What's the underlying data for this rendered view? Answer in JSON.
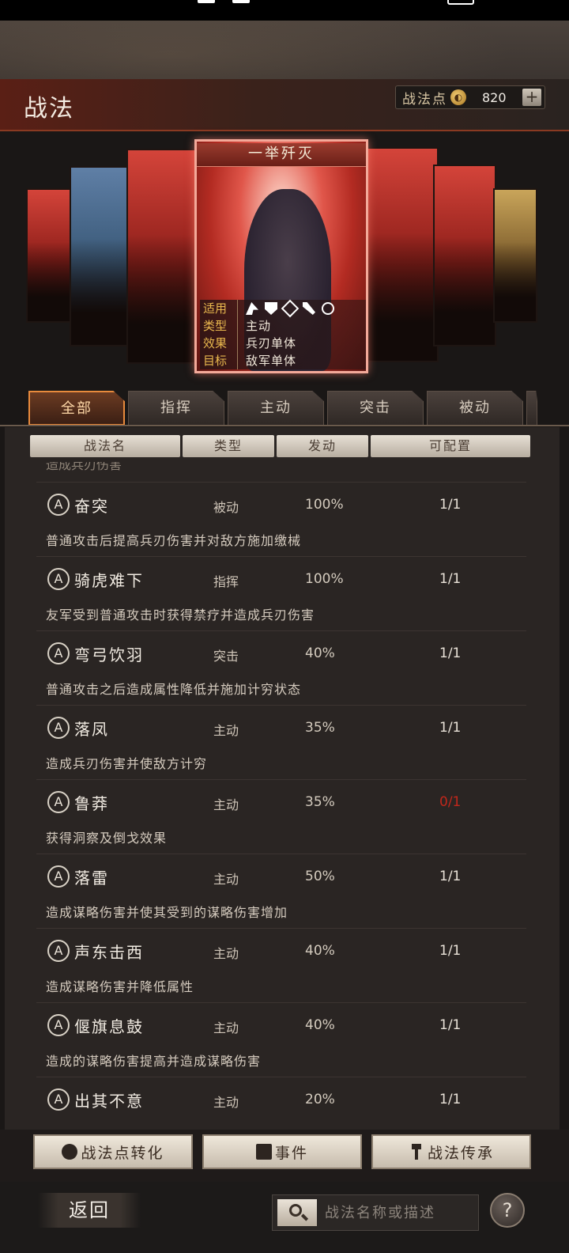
{
  "header": {
    "title": "战法",
    "points_label": "战法点",
    "points_value": "820",
    "plus_label": "+"
  },
  "featured_card": {
    "title": "一举歼灭",
    "rows": [
      {
        "key": "适用",
        "value": ""
      },
      {
        "key": "类型",
        "value": "主动"
      },
      {
        "key": "效果",
        "value": "兵刃单体"
      },
      {
        "key": "目标",
        "value": "敌军单体"
      }
    ],
    "troop_icons": [
      "cavalry-icon",
      "shield-icon",
      "bow-icon",
      "spear-icon",
      "siege-icon"
    ]
  },
  "tabs": [
    {
      "label": "全部",
      "active": true
    },
    {
      "label": "指挥"
    },
    {
      "label": "主动"
    },
    {
      "label": "突击"
    },
    {
      "label": "被动"
    }
  ],
  "columns": [
    "战法名",
    "类型",
    "发动",
    "可配置"
  ],
  "partial_row_text": "造成兵刃伤害",
  "skills": [
    {
      "grade": "A",
      "name": "奋突",
      "type": "被动",
      "rate": "100%",
      "avail": "1/1",
      "desc": "普通攻击后提高兵刃伤害并对敌方施加缴械"
    },
    {
      "grade": "A",
      "name": "骑虎难下",
      "type": "指挥",
      "rate": "100%",
      "avail": "1/1",
      "desc": "友军受到普通攻击时获得禁疗并造成兵刃伤害"
    },
    {
      "grade": "A",
      "name": "弯弓饮羽",
      "type": "突击",
      "rate": "40%",
      "avail": "1/1",
      "desc": "普通攻击之后造成属性降低并施加计穷状态"
    },
    {
      "grade": "A",
      "name": "落凤",
      "type": "主动",
      "rate": "35%",
      "avail": "1/1",
      "desc": "造成兵刃伤害并使敌方计穷"
    },
    {
      "grade": "A",
      "name": "鲁莽",
      "type": "主动",
      "rate": "35%",
      "avail": "0/1",
      "desc": "获得洞察及倒戈效果"
    },
    {
      "grade": "A",
      "name": "落雷",
      "type": "主动",
      "rate": "50%",
      "avail": "1/1",
      "desc": "造成谋略伤害并使其受到的谋略伤害增加"
    },
    {
      "grade": "A",
      "name": "声东击西",
      "type": "主动",
      "rate": "40%",
      "avail": "1/1",
      "desc": "造成谋略伤害并降低属性"
    },
    {
      "grade": "A",
      "name": "偃旗息鼓",
      "type": "主动",
      "rate": "40%",
      "avail": "1/1",
      "desc": "造成的谋略伤害提高并造成谋略伤害"
    },
    {
      "grade": "A",
      "name": "出其不意",
      "type": "主动",
      "rate": "20%",
      "avail": "1/1",
      "desc": ""
    }
  ],
  "actions": {
    "convert": "战法点转化",
    "event": "事件",
    "inherit": "战法传承"
  },
  "footer": {
    "back": "返回",
    "search_placeholder": "战法名称或描述",
    "help": "?"
  },
  "colors": {
    "accent": "#e88a3c",
    "unavailable": "#c1271b"
  }
}
